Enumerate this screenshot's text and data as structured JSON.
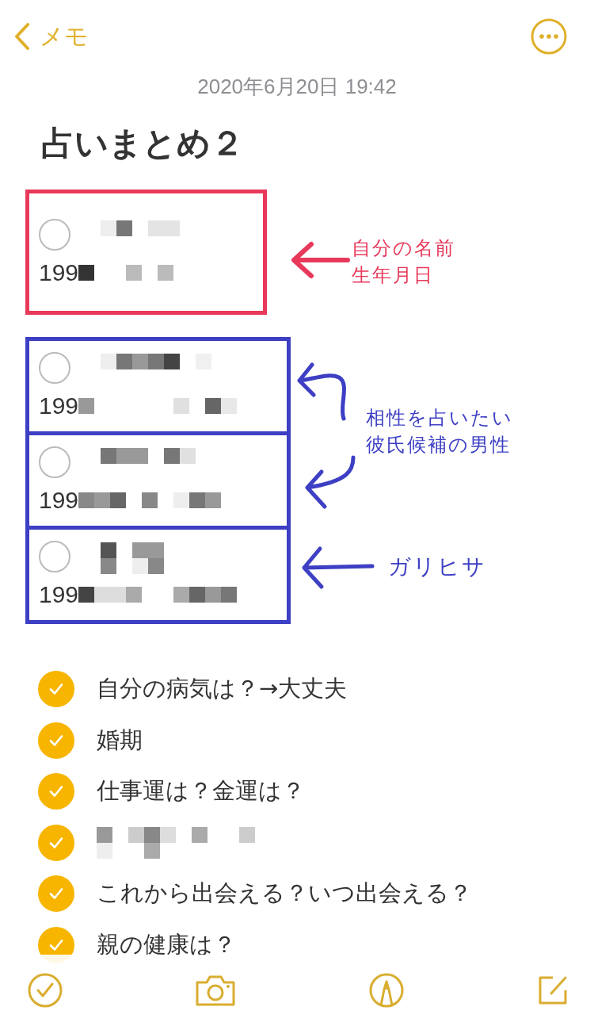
{
  "nav": {
    "back_label": "メモ"
  },
  "date": "2020年6月20日 19:42",
  "title": "占いまとめ２",
  "groups": [
    {
      "color": "#e8395a",
      "items": [
        {
          "checked": false,
          "text": "199"
        }
      ]
    },
    {
      "color": "#3d3fc4",
      "items": [
        {
          "checked": false,
          "text": "199"
        },
        {
          "checked": false,
          "text": "199"
        },
        {
          "checked": false,
          "text": "199"
        }
      ]
    }
  ],
  "annotations": [
    {
      "color": "#e8395a",
      "lines": [
        "自分の名前",
        "生年月日"
      ]
    },
    {
      "color": "#3d3fc4",
      "lines": [
        "相性を占いたい",
        "彼氏候補の男性"
      ]
    },
    {
      "color": "#3d3fc4",
      "lines": [
        "ガリヒサ"
      ]
    }
  ],
  "tasks": [
    {
      "kind": "text",
      "checked": true,
      "text": "自分の病気は？→大丈夫"
    },
    {
      "kind": "text",
      "checked": true,
      "text": "婚期"
    },
    {
      "kind": "text",
      "checked": true,
      "text": "仕事運は？金運は？"
    },
    {
      "kind": "redacted",
      "checked": true
    },
    {
      "kind": "text",
      "checked": true,
      "text": "これから出会える？いつ出会える？"
    },
    {
      "kind": "text",
      "checked": true,
      "text": "親の健康は？"
    }
  ]
}
